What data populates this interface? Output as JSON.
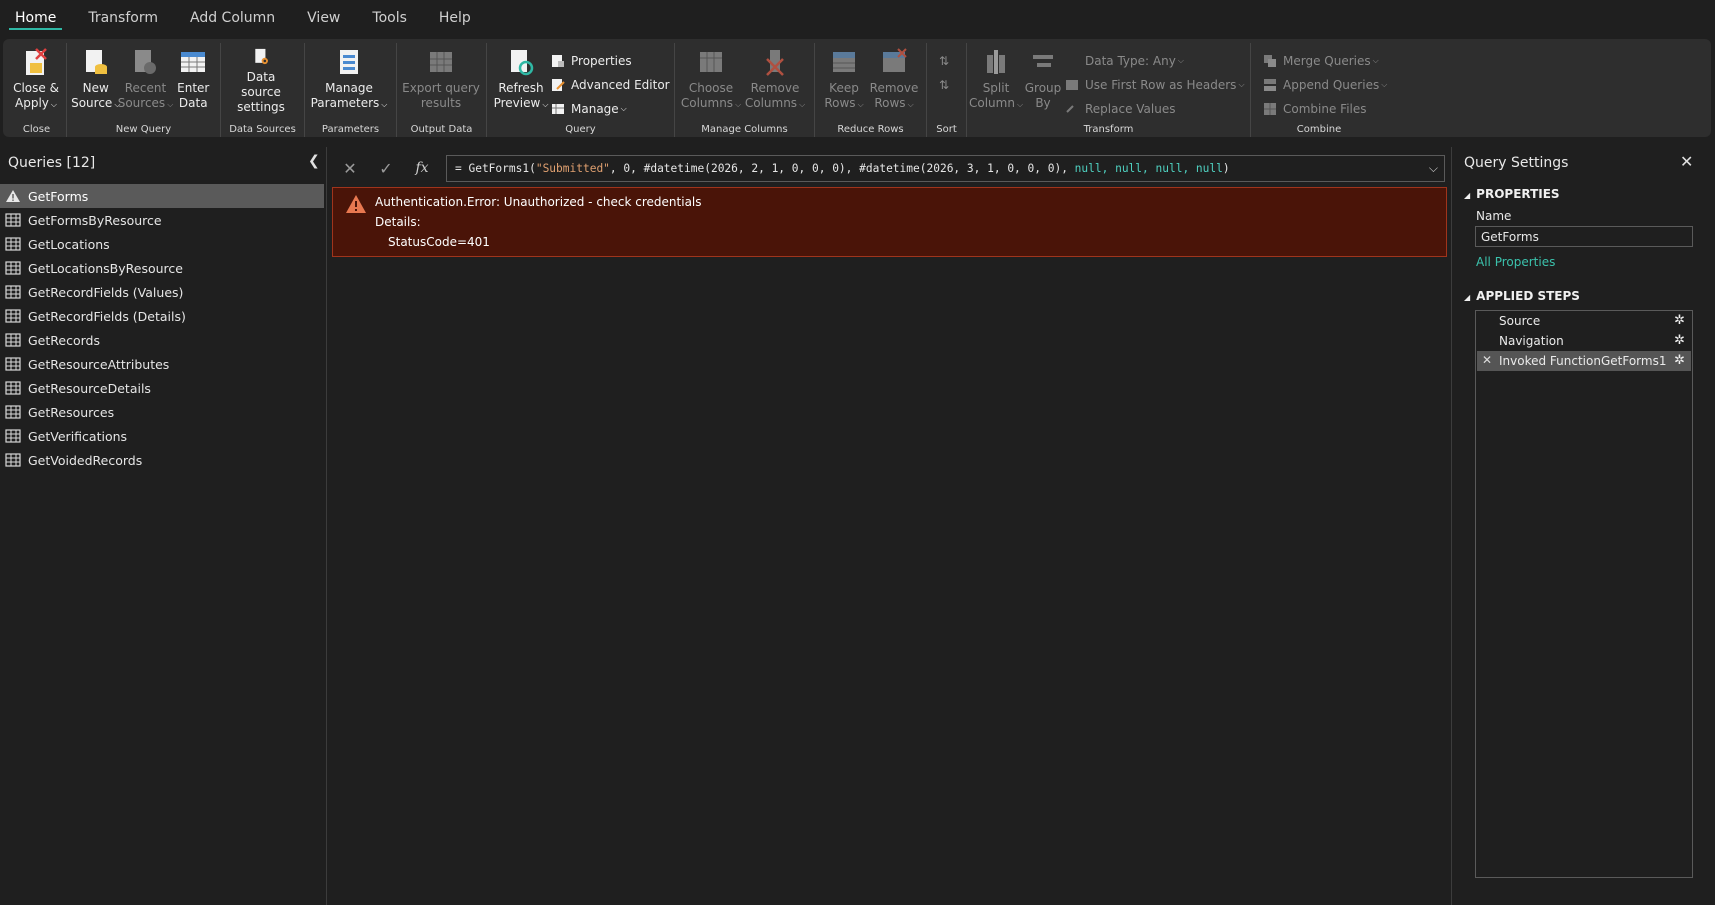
{
  "menu": {
    "tabs": [
      {
        "label": "Home",
        "active": true
      },
      {
        "label": "Transform"
      },
      {
        "label": "Add Column"
      },
      {
        "label": "View"
      },
      {
        "label": "Tools"
      },
      {
        "label": "Help"
      }
    ]
  },
  "ribbon": {
    "close": {
      "label": "Close",
      "close_apply": "Close &",
      "close_apply2": "Apply"
    },
    "new_query": {
      "label": "New Query",
      "new_source": "New",
      "new_source2": "Source",
      "recent_sources": "Recent",
      "recent_sources2": "Sources",
      "enter_data": "Enter",
      "enter_data2": "Data"
    },
    "data_sources": {
      "label": "Data Sources",
      "settings": "Data source",
      "settings2": "settings"
    },
    "parameters": {
      "label": "Parameters",
      "manage": "Manage",
      "manage2": "Parameters"
    },
    "output_data": {
      "label": "Output Data",
      "export": "Export query",
      "export2": "results"
    },
    "query": {
      "label": "Query",
      "refresh": "Refresh",
      "refresh2": "Preview",
      "properties": "Properties",
      "advanced_editor": "Advanced Editor",
      "manage": "Manage"
    },
    "manage_columns": {
      "label": "Manage Columns",
      "choose": "Choose",
      "choose2": "Columns",
      "remove": "Remove",
      "remove2": "Columns"
    },
    "reduce_rows": {
      "label": "Reduce Rows",
      "keep": "Keep",
      "keep2": "Rows",
      "remove": "Remove",
      "remove2": "Rows"
    },
    "sort": {
      "label": "Sort"
    },
    "transform": {
      "label": "Transform",
      "split": "Split",
      "split2": "Column",
      "group": "Group",
      "group2": "By",
      "data_type": "Data Type: Any",
      "first_row": "Use First Row as Headers",
      "replace": "Replace Values"
    },
    "combine": {
      "label": "Combine",
      "merge": "Merge Queries",
      "append": "Append Queries",
      "combine_files": "Combine Files"
    }
  },
  "queries": {
    "title": "Queries [12]",
    "items": [
      {
        "label": "GetForms",
        "selected": true,
        "error": true
      },
      {
        "label": "GetFormsByResource"
      },
      {
        "label": "GetLocations"
      },
      {
        "label": "GetLocationsByResource"
      },
      {
        "label": "GetRecordFields (Values)"
      },
      {
        "label": "GetRecordFields (Details)"
      },
      {
        "label": "GetRecords"
      },
      {
        "label": "GetResourceAttributes"
      },
      {
        "label": "GetResourceDetails"
      },
      {
        "label": "GetResources"
      },
      {
        "label": "GetVerifications"
      },
      {
        "label": "GetVoidedRecords"
      }
    ]
  },
  "formula": {
    "prefix": "= GetForms1(",
    "str": "\"Submitted\"",
    "mid": ", 0, #datetime(2026, 2, 1, 0, 0, 0), #datetime(2026, 3, 1, 0, 0, 0), ",
    "nulls": "null, null, null, null",
    "suffix": ")"
  },
  "error": {
    "message": "Authentication.Error: Unauthorized - check credentials",
    "details_label": "Details:",
    "status": "StatusCode=401"
  },
  "settings": {
    "title": "Query Settings",
    "properties_label": "PROPERTIES",
    "name_label": "Name",
    "name_value": "GetForms",
    "all_properties": "All Properties",
    "steps_label": "APPLIED STEPS",
    "steps": [
      {
        "label": "Source"
      },
      {
        "label": "Navigation"
      },
      {
        "label": "Invoked FunctionGetForms1",
        "selected": true
      }
    ]
  },
  "colors": {
    "accent": "#2fb8a5",
    "error_bg": "#4a1408",
    "error_border": "#a0341c",
    "link": "#3bc2ac"
  }
}
